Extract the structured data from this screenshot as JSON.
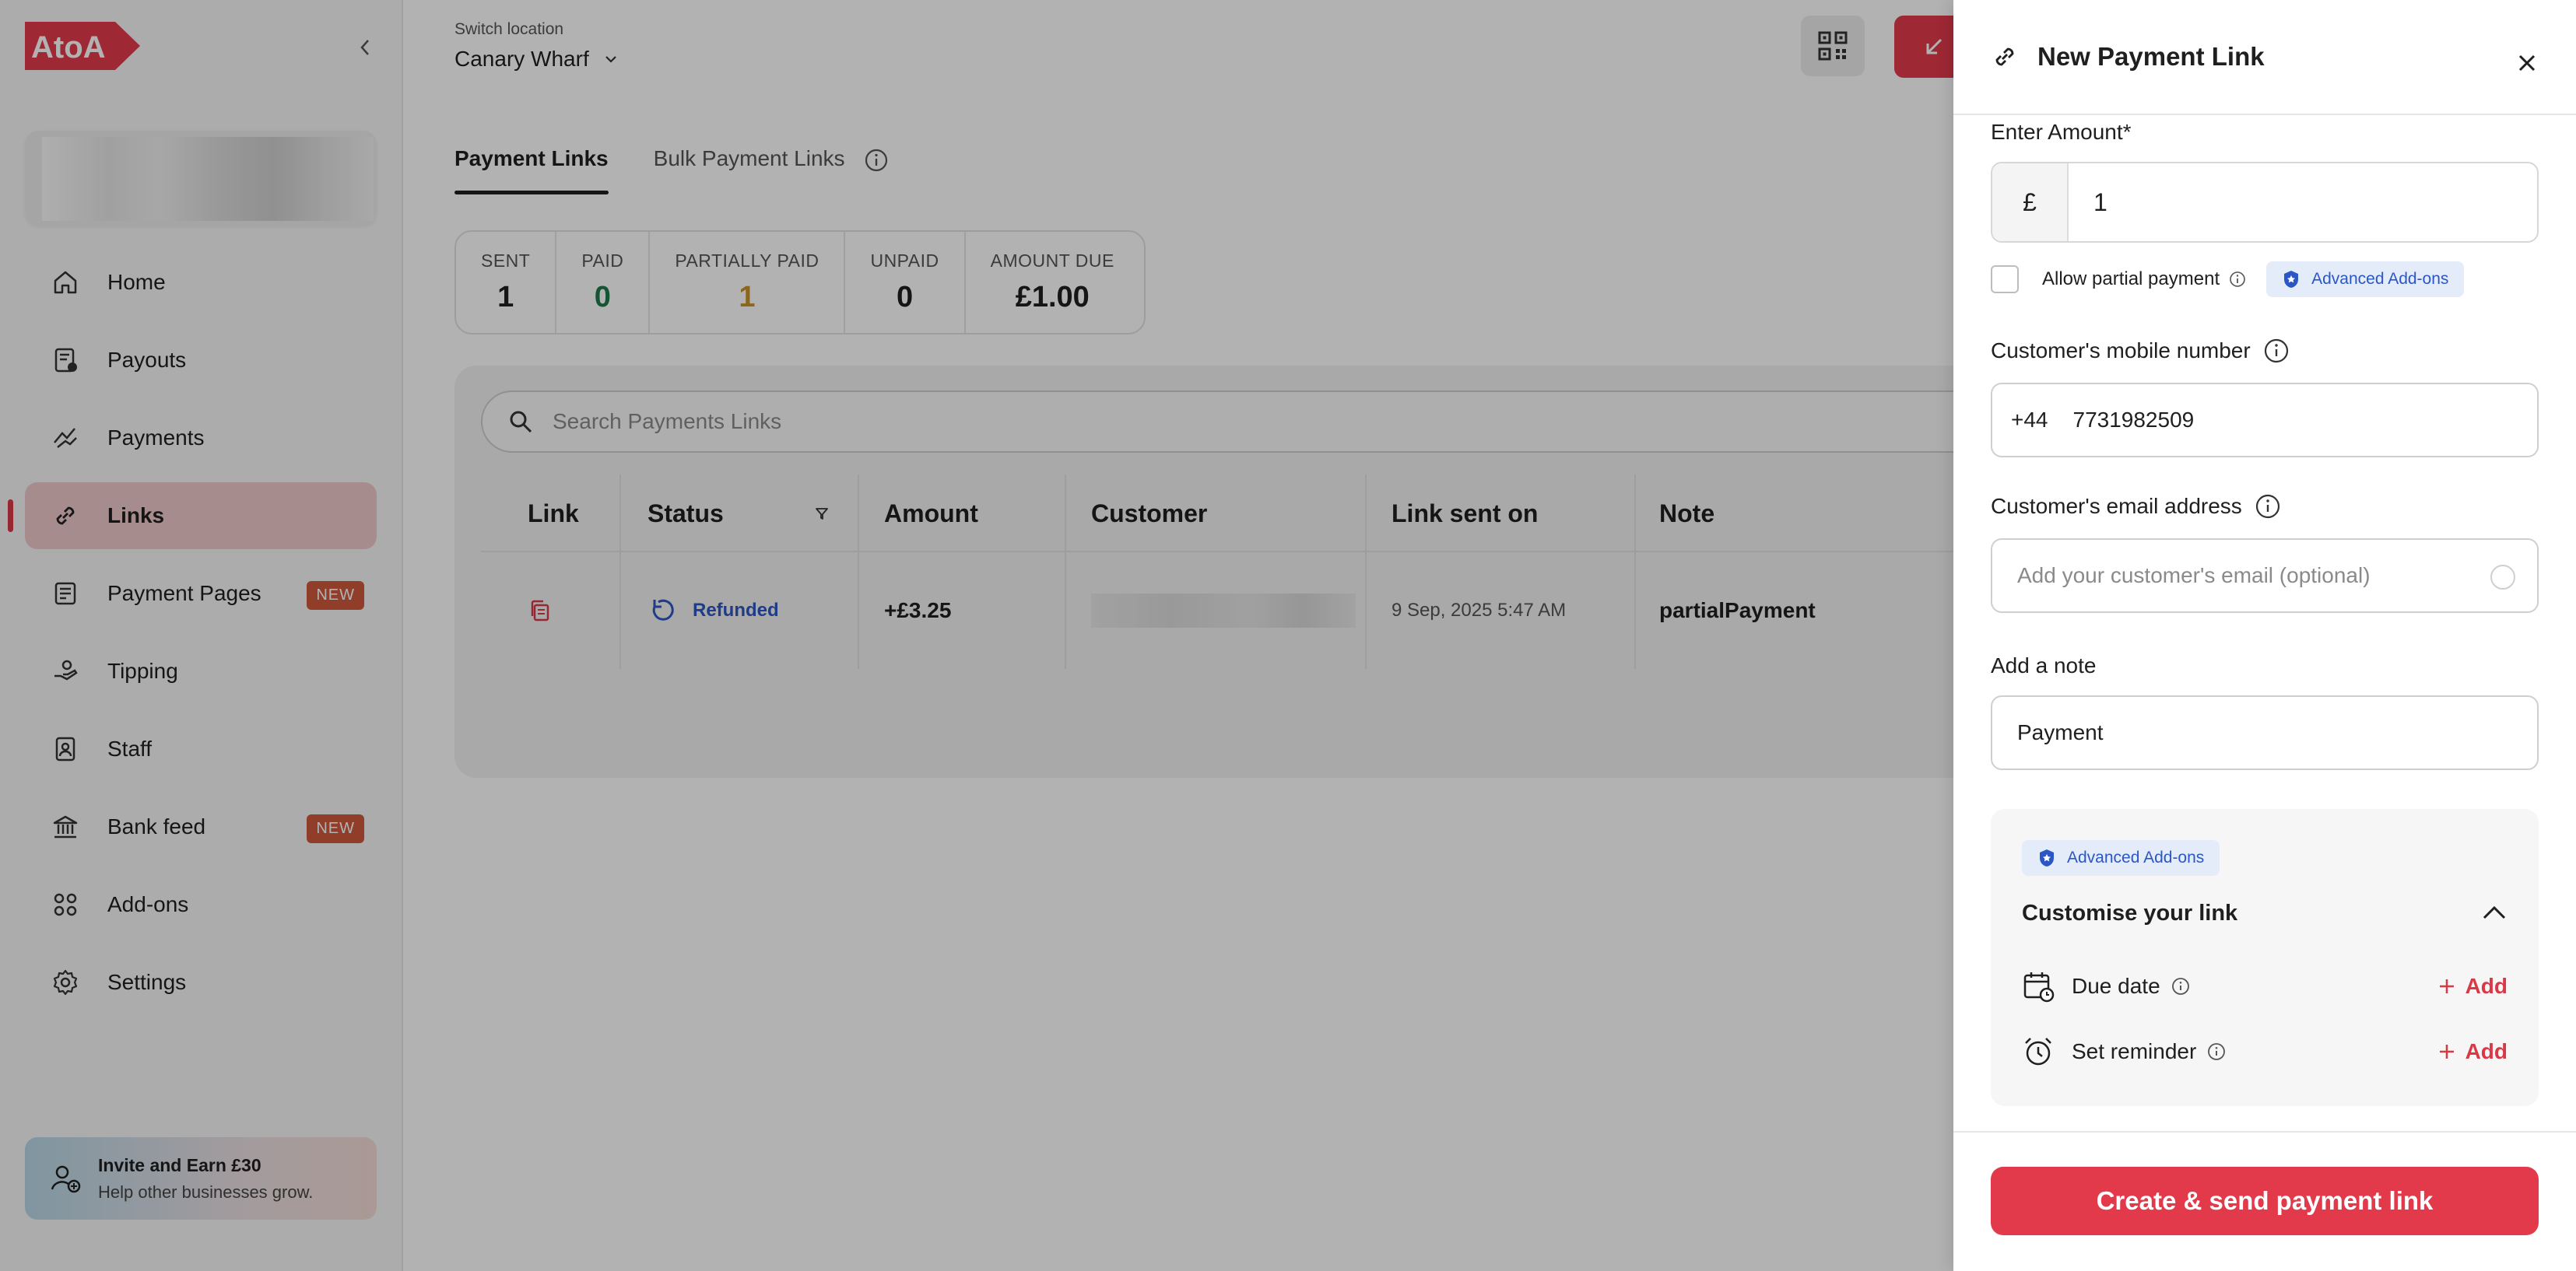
{
  "brand": {
    "logo_text": "AtoA",
    "accent": "#e23a4b"
  },
  "sidebar": {
    "items": [
      {
        "label": "Home",
        "icon": "home-icon"
      },
      {
        "label": "Payouts",
        "icon": "payouts-icon"
      },
      {
        "label": "Payments",
        "icon": "payments-icon"
      },
      {
        "label": "Links",
        "icon": "link-icon",
        "active": true
      },
      {
        "label": "Payment Pages",
        "icon": "payment-pages-icon",
        "badge": "NEW"
      },
      {
        "label": "Tipping",
        "icon": "tipping-icon"
      },
      {
        "label": "Staff",
        "icon": "staff-icon"
      },
      {
        "label": "Bank feed",
        "icon": "bank-icon",
        "badge": "NEW"
      },
      {
        "label": "Add-ons",
        "icon": "addons-icon"
      },
      {
        "label": "Settings",
        "icon": "settings-icon"
      }
    ],
    "invite": {
      "title": "Invite and Earn £30",
      "subtitle": "Help other businesses grow."
    }
  },
  "header": {
    "location_label": "Switch location",
    "location_value": "Canary Wharf"
  },
  "tabs": [
    {
      "label": "Payment Links",
      "active": true
    },
    {
      "label": "Bulk Payment Links"
    }
  ],
  "stats": [
    {
      "label": "SENT",
      "value": "1",
      "color": "#1f1f1f"
    },
    {
      "label": "PAID",
      "value": "0",
      "color": "#1f7a4a"
    },
    {
      "label": "PARTIALLY PAID",
      "value": "1",
      "color": "#c8922c"
    },
    {
      "label": "UNPAID",
      "value": "0",
      "color": "#1f1f1f"
    },
    {
      "label": "AMOUNT DUE",
      "value": "£1.00",
      "color": "#1f1f1f"
    }
  ],
  "search": {
    "placeholder": "Search Payments Links"
  },
  "table": {
    "columns": [
      "Link",
      "Status",
      "Amount",
      "Customer",
      "Link sent on",
      "Note"
    ],
    "rows": [
      {
        "status": "Refunded",
        "amount": "+£3.25",
        "sent_on": "9 Sep, 2025 5:47 AM",
        "note": "partialPayment"
      }
    ]
  },
  "drawer": {
    "title": "New Payment Link",
    "amount_label": "Enter Amount*",
    "currency": "£",
    "amount_value": "1",
    "partial_label": "Allow partial payment",
    "addon_label": "Advanced Add-ons",
    "mobile_label": "Customer's mobile number",
    "mobile_prefix": "+44",
    "mobile_value": "7731982509",
    "email_label": "Customer's email address",
    "email_placeholder": "Add your customer's email (optional)",
    "note_label": "Add a note",
    "note_value": "Payment",
    "customise": {
      "addon_label": "Advanced Add-ons",
      "title": "Customise your link",
      "due_date_label": "Due date",
      "reminder_label": "Set reminder",
      "add_label": "Add"
    },
    "submit_label": "Create & send payment link"
  }
}
